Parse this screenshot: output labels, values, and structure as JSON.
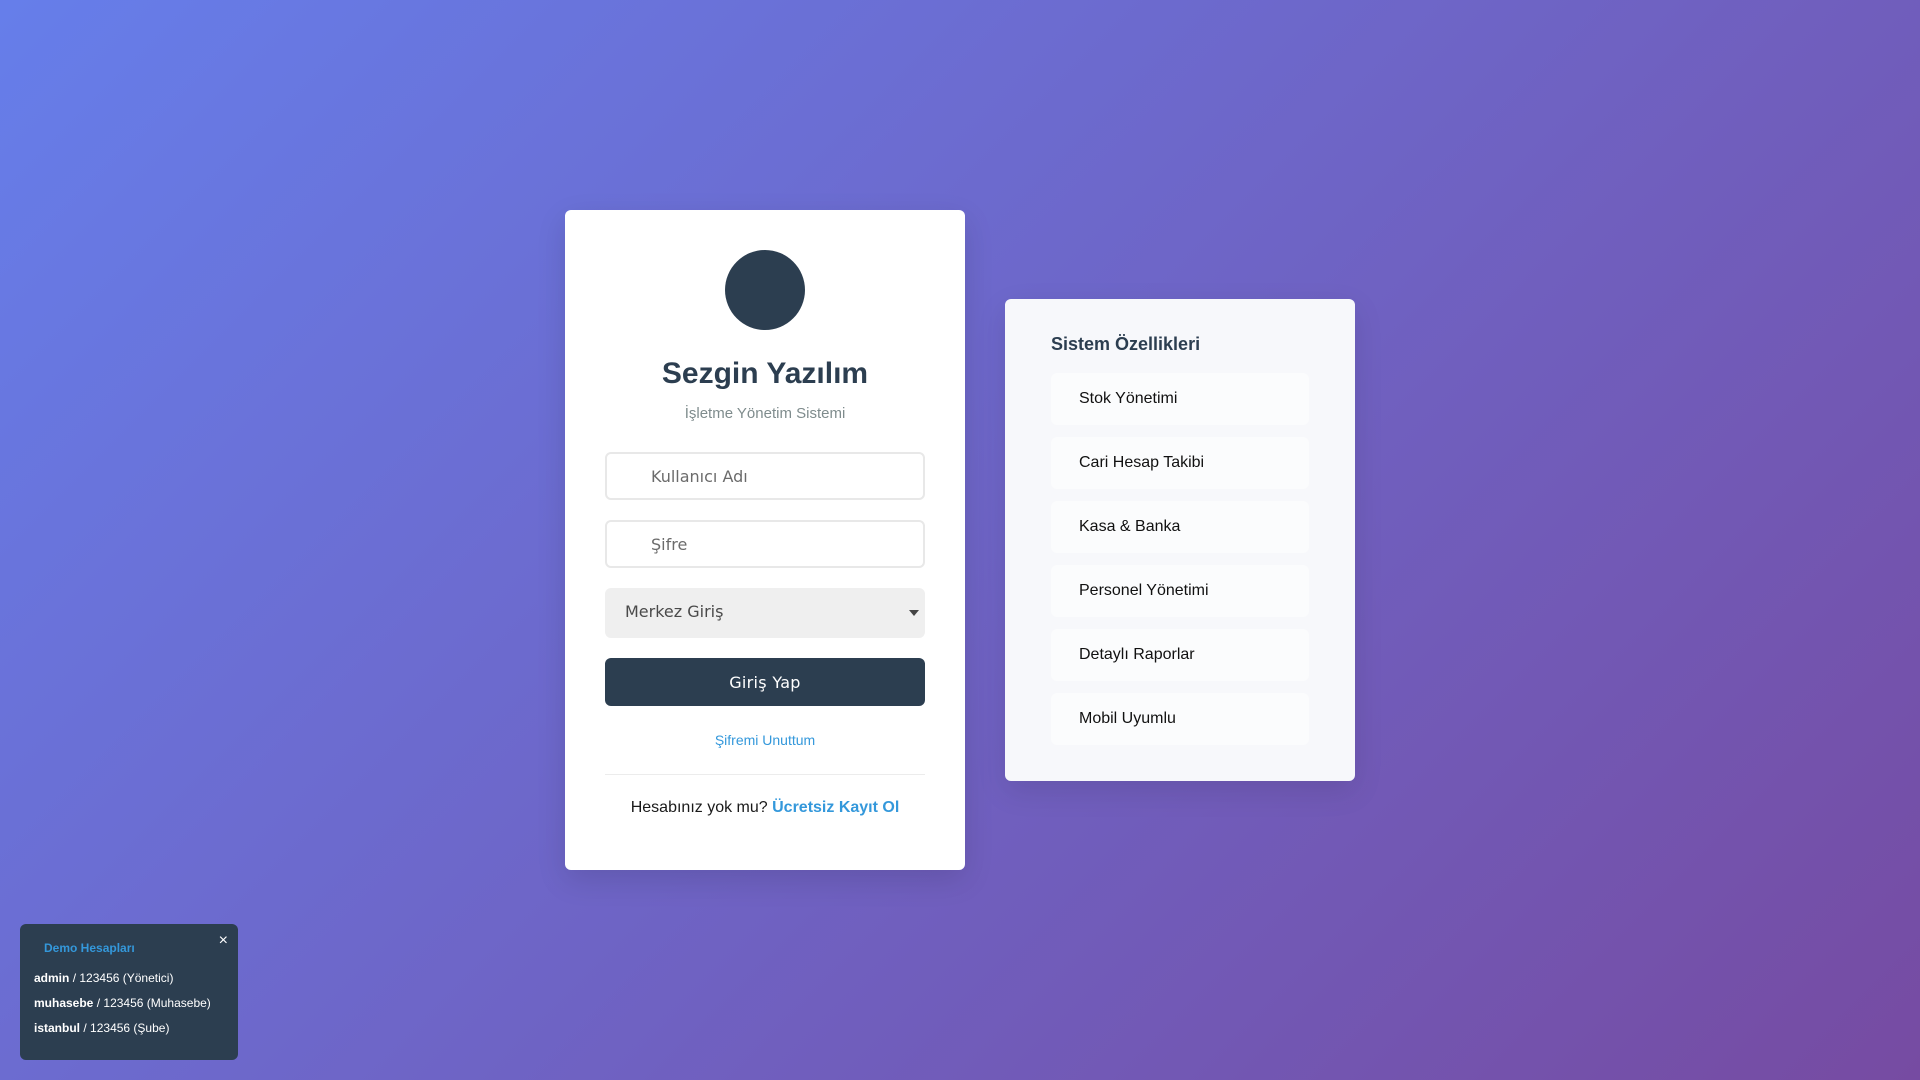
{
  "login": {
    "brand": "Sezgin Yazılım",
    "subtitle": "İşletme Yönetim Sistemi",
    "username_placeholder": "Kullanıcı Adı",
    "password_placeholder": "Şifre",
    "login_type_selected": "Merkez Giriş",
    "login_button": "Giriş Yap",
    "forgot_password": "Şifremi Unuttum",
    "register_prompt": "Hesabınız yok mu?",
    "register_link": "Ücretsiz Kayıt Ol"
  },
  "features": {
    "title": "Sistem Özellikleri",
    "items": [
      {
        "label": "Stok Yönetimi"
      },
      {
        "label": "Cari Hesap Takibi"
      },
      {
        "label": "Kasa & Banka"
      },
      {
        "label": "Personel Yönetimi"
      },
      {
        "label": "Detaylı Raporlar"
      },
      {
        "label": "Mobil Uyumlu"
      }
    ]
  },
  "demo": {
    "title": "Demo Hesapları",
    "close": "×",
    "accounts": [
      {
        "user": "admin",
        "sep": "/",
        "info": "123456 (Yönetici)"
      },
      {
        "user": "muhasebe",
        "sep": "/",
        "info": "123456 (Muhasebe)"
      },
      {
        "user": "istanbul",
        "sep": "/",
        "info": "123456 (Şube)"
      }
    ]
  },
  "colors": {
    "primary_dark": "#2c3e50",
    "link_blue": "#3498db",
    "background_start": "#667eea",
    "background_end": "#764ba2"
  }
}
